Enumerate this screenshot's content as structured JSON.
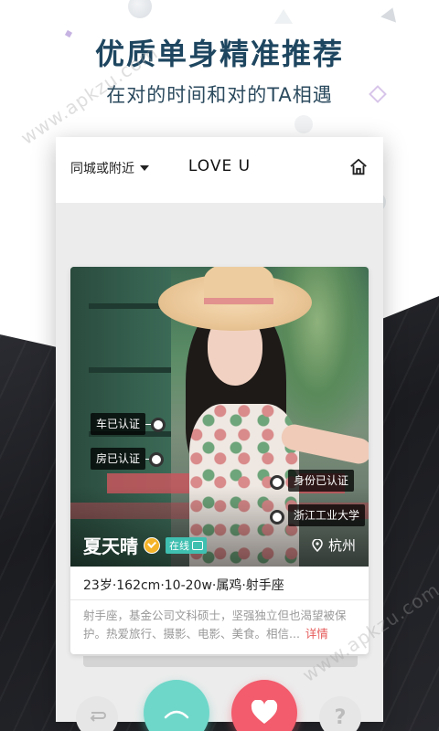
{
  "promo": {
    "headline": "优质单身精准推荐",
    "subline": "在对的时间和对的TA相遇"
  },
  "app": {
    "city_filter": "同城或附近",
    "title": "LOVE U"
  },
  "profile": {
    "name": "夏天晴",
    "online": "在线",
    "location": "杭州",
    "tags": [
      "车已认证",
      "房已认证",
      "身份已认证",
      "浙江工业大学"
    ],
    "stats": "23岁·162cm·10-20w·属鸡·射手座",
    "bio": "射手座，基金公司文科硕士，坚强独立但也渴望被保护。热爱旅行、摄影、电影、美食。相信...",
    "more": "详情"
  },
  "actions": {
    "help_label": "?"
  },
  "watermark": {
    "top": "www.apkzu.com",
    "bottom": "www.apkzu.com"
  },
  "colors": {
    "headline": "#1e4660",
    "skip": "#6fd7c9",
    "like": "#f25c6c",
    "online": "#3fbfb0",
    "more": "#e65a5a"
  }
}
